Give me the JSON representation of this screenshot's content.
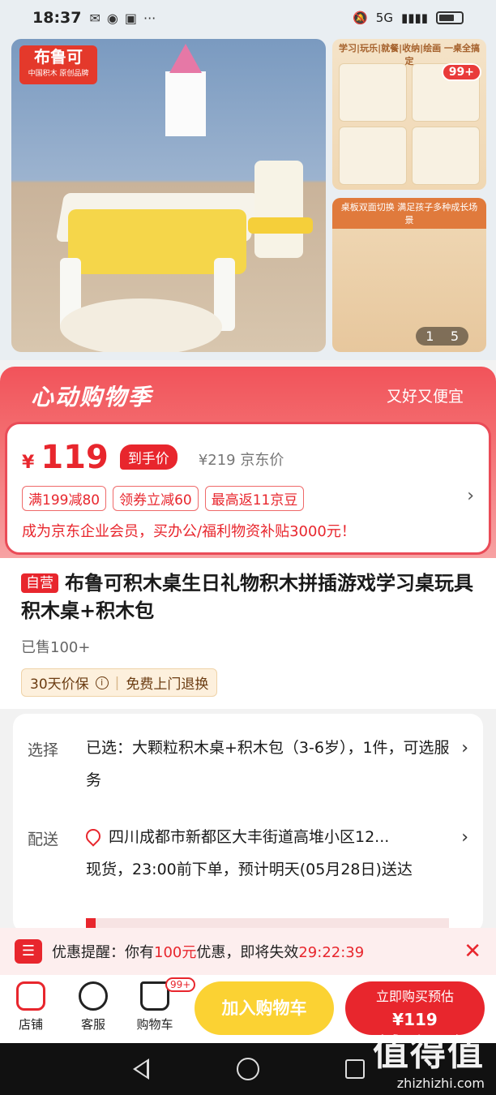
{
  "status_bar": {
    "time": "18:37",
    "network": "5G"
  },
  "gallery": {
    "brand_logo": {
      "name": "布鲁可",
      "tagline": "中国积木 原创品牌"
    },
    "side_top_banner": "学习|玩乐|就餐|收纳|绘画  一桌全搞定",
    "side_top_badge": "99+",
    "side_bottom_banner": "桌板双面切换 满足孩子多种成长场景",
    "pager_current": "1",
    "pager_total": "5"
  },
  "promo": {
    "title": "心动购物季",
    "subtitle": "又好又便宜",
    "currency": "¥",
    "price": "119",
    "price_tag": "到手价",
    "original_price": "¥219 京东价",
    "coupons": [
      "满199减80",
      "领券立减60",
      "最高返11京豆"
    ],
    "member_text": "成为京东企业会员，买办公/福利物资补贴3000元！"
  },
  "product": {
    "self_tag": "自营",
    "title": "布鲁可积木桌生日礼物积木拼插游戏学习桌玩具积木桌+积木包",
    "sold": "已售100+",
    "guarantee_1": "30天价保",
    "guarantee_2": "免费上门退换"
  },
  "options": {
    "select_label": "选择",
    "select_value": "已选：大颗粒积木桌+积木包（3-6岁），1件，可选服务",
    "delivery_label": "配送",
    "address": "四川成都市新都区大丰街道高堆小区12...",
    "delivery_value": "现货，23:00前下单，预计明天(05月28日)送达"
  },
  "reminder": {
    "prefix": "优惠提醒：你有",
    "amount": "100元",
    "middle": "优惠，即将失效",
    "countdown": "29:22:39"
  },
  "bottom_bar": {
    "store": "店铺",
    "service": "客服",
    "cart": "购物车",
    "cart_badge": "99+",
    "add_to_cart": "加入购物车",
    "buy_now_line1": "立即购买预估",
    "buy_now_line2": "¥119"
  },
  "watermark": {
    "big": "值得值",
    "url": "zhizhizhi.com"
  },
  "colors": {
    "accent": "#e8262d",
    "cart_button": "#fbd233",
    "promo_bg": "#f2535a"
  }
}
